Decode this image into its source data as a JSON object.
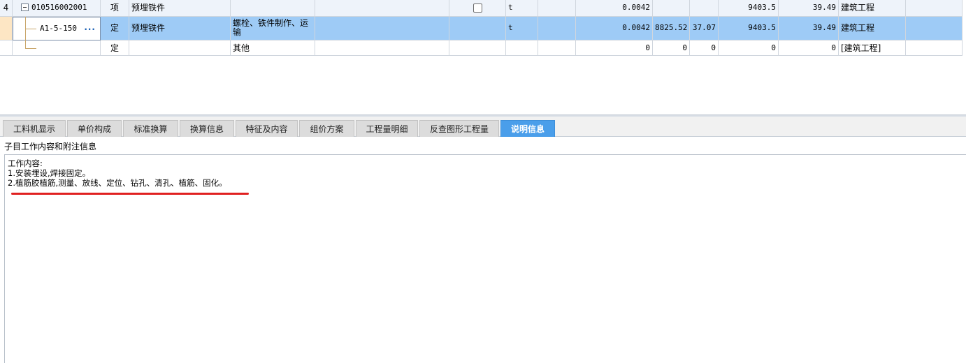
{
  "grid": {
    "rows": [
      {
        "seq": "4",
        "code": "010516002001",
        "type": "项",
        "name": "预埋铁件",
        "feature": "",
        "content": "",
        "unit": "t",
        "quantity": "0.0042",
        "price": "",
        "sub": "",
        "total": "9403.5",
        "amount": "39.49",
        "profession": "建筑工程"
      },
      {
        "seq": "",
        "code": "A1-5-150",
        "type": "定",
        "name": "预埋铁件",
        "feature": "螺栓、铁件制作、运输",
        "feature_line1": "螺栓、铁件制作、运",
        "feature_line2": "输",
        "unit": "t",
        "quantity": "0.0042",
        "price": "8825.52",
        "sub": "37.07",
        "total": "9403.5",
        "amount": "39.49",
        "profession": "建筑工程"
      },
      {
        "seq": "",
        "code": "",
        "type": "定",
        "name": "",
        "feature": "其他",
        "unit": "",
        "quantity": "0",
        "price": "0",
        "sub": "0",
        "total": "0",
        "amount": "0",
        "profession": "[建筑工程]"
      }
    ],
    "more_icon": "ellipsis-icon"
  },
  "tabs": [
    {
      "label": "工料机显示",
      "active": false
    },
    {
      "label": "单价构成",
      "active": false
    },
    {
      "label": "标准换算",
      "active": false
    },
    {
      "label": "换算信息",
      "active": false
    },
    {
      "label": "特征及内容",
      "active": false
    },
    {
      "label": "组价方案",
      "active": false
    },
    {
      "label": "工程量明细",
      "active": false
    },
    {
      "label": "反查图形工程量",
      "active": false
    },
    {
      "label": "说明信息",
      "active": true
    }
  ],
  "detail": {
    "section_title": "子目工作内容和附注信息",
    "lines": [
      "工作内容:",
      "1.安装埋设,焊接固定。",
      "2.植筋胶植筋,测量、放线、定位、钻孔、清孔、植筋、固化。"
    ]
  },
  "colors": {
    "selected_row": "#9ecbf6",
    "active_tab": "#4a9eea",
    "annotation": "#e02020"
  }
}
